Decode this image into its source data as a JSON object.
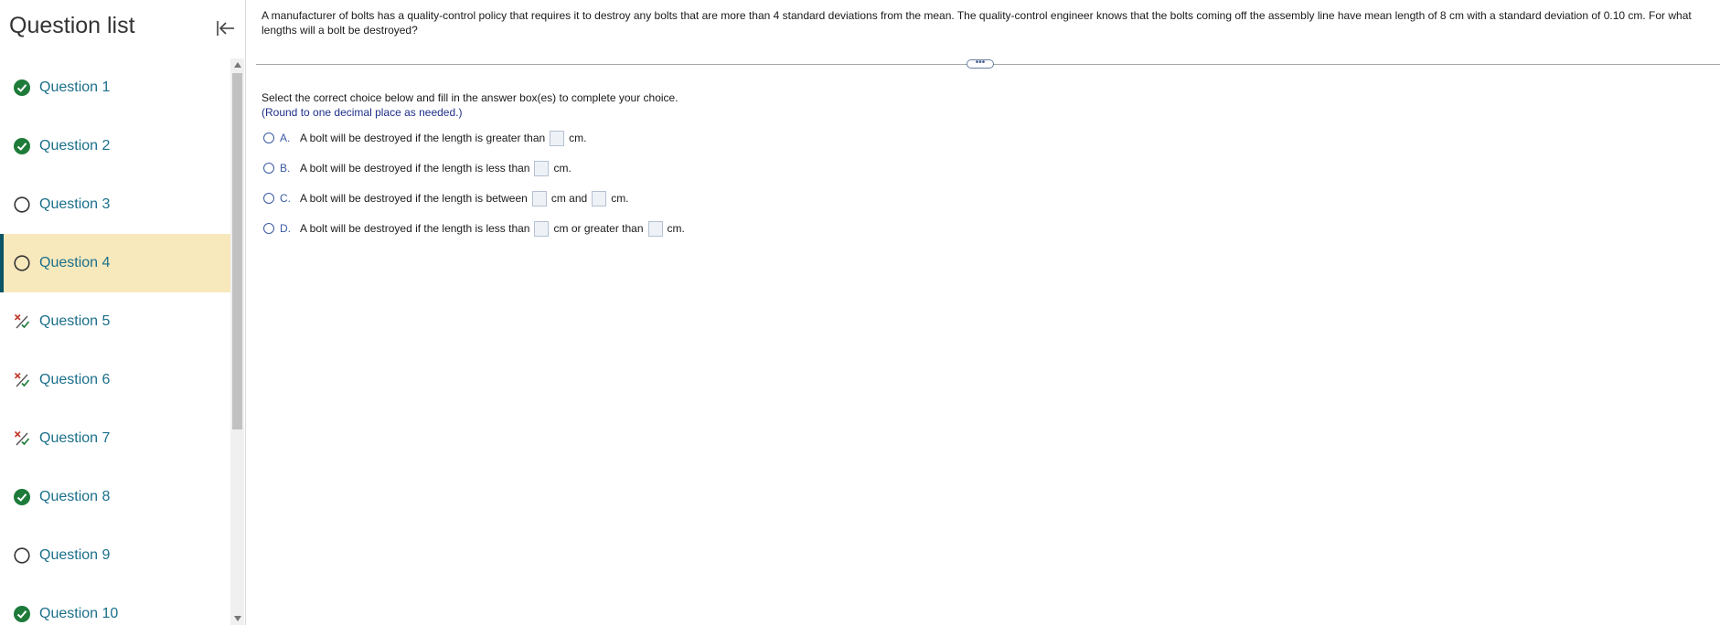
{
  "sidebar": {
    "title": "Question list",
    "questions": [
      {
        "label": "Question 1",
        "status": "correct"
      },
      {
        "label": "Question 2",
        "status": "correct"
      },
      {
        "label": "Question 3",
        "status": "unanswered"
      },
      {
        "label": "Question 4",
        "status": "unanswered"
      },
      {
        "label": "Question 5",
        "status": "partial"
      },
      {
        "label": "Question 6",
        "status": "partial"
      },
      {
        "label": "Question 7",
        "status": "partial"
      },
      {
        "label": "Question 8",
        "status": "correct"
      },
      {
        "label": "Question 9",
        "status": "unanswered"
      },
      {
        "label": "Question 10",
        "status": "correct"
      }
    ]
  },
  "question": {
    "text": "A manufacturer of bolts has a quality-control policy that requires it to destroy any bolts that are more than 4 standard deviations from the mean. The quality-control engineer knows that the bolts coming off the assembly line have mean length of 8 cm with a standard deviation of 0.10 cm. For what lengths will a bolt be destroyed?",
    "expand_label": "•••",
    "instruction": "Select the correct choice below and fill in the answer box(es) to complete your choice.",
    "round_note": "(Round to one decimal place as needed.)"
  },
  "choices": [
    {
      "letter": "A.",
      "text_before": "A bolt will be destroyed if the length is greater than",
      "text_after": "cm."
    },
    {
      "letter": "B.",
      "text_before": "A bolt will be destroyed if the length is less than",
      "text_after": "cm."
    },
    {
      "letter": "C.",
      "text_before": "A bolt will be destroyed if the length is between",
      "text_mid": "cm and",
      "text_after": "cm."
    },
    {
      "letter": "D.",
      "text_before": "A bolt will be destroyed if the length is less than",
      "text_mid": "cm or greater than",
      "text_after": "cm."
    }
  ],
  "colors": {
    "correct": "#1e7b3a",
    "partial_x": "#c0392b",
    "partial_check": "#1e7b3a",
    "unanswered": "#333333",
    "active_bg": "#f8e9bd",
    "active_border": "#0a5566",
    "link": "#1a6f8a"
  },
  "icons": {
    "correct": "check-circle-icon",
    "unanswered": "empty-circle-icon",
    "partial": "partial-credit-icon",
    "collapse": "collapse-left-icon"
  },
  "active_question_index": 3
}
